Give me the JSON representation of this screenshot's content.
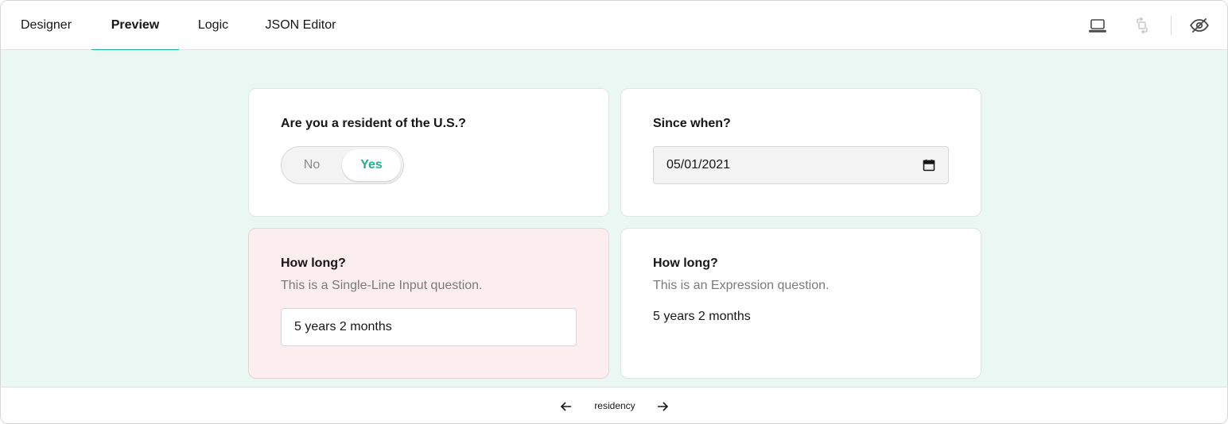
{
  "tabs": [
    {
      "label": "Designer",
      "active": false
    },
    {
      "label": "Preview",
      "active": true
    },
    {
      "label": "Logic",
      "active": false
    },
    {
      "label": "JSON Editor",
      "active": false
    }
  ],
  "toolbar": {
    "icons": [
      "laptop-icon",
      "orientation-rotate-icon",
      "eye-off-icon"
    ]
  },
  "colors": {
    "accent": "#19b394",
    "preview_background": "#ebf7f3",
    "error_card_background": "#fcedef"
  },
  "questions": {
    "resident": {
      "title": "Are you a resident of the U.S.?",
      "options": [
        "No",
        "Yes"
      ],
      "selected": "Yes"
    },
    "since_when": {
      "title": "Since when?",
      "value": "05/01/2021"
    },
    "how_long_input": {
      "title": "How long?",
      "description": "This is a Single-Line Input question.",
      "value": "5 years 2 months"
    },
    "how_long_expression": {
      "title": "How long?",
      "description": "This is an Expression question.",
      "value": "5 years 2 months"
    }
  },
  "navigation": {
    "page_name": "residency"
  }
}
